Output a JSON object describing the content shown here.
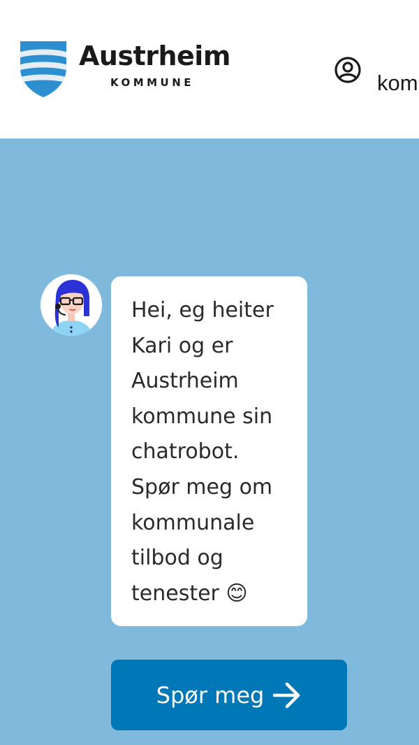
{
  "header": {
    "brand_title": "Austrheim",
    "brand_subtitle": "KOMMUNE",
    "user_link_label": "kom",
    "logo_icon": "austrheim-coat-of-arms-icon",
    "user_icon": "user-circle-icon"
  },
  "chat": {
    "avatar_icon": "chatbot-kari-avatar-icon",
    "greeting_lines": [
      "Hei, eg heiter",
      "Kari og er",
      "Austrheim",
      "kommune sin",
      "chatrobot.",
      "Spør meg om",
      "kommunale",
      "tilbod og",
      "tenester 😊"
    ],
    "cta_label": "Spør meg",
    "cta_icon": "arrow-right-icon"
  },
  "colors": {
    "background": "#7fbadc",
    "header_bg": "#ffffff",
    "bubble_bg": "#ffffff",
    "button_bg": "#0077b6",
    "logo_blue": "#2d8fd0",
    "text": "#1a1a1a"
  }
}
